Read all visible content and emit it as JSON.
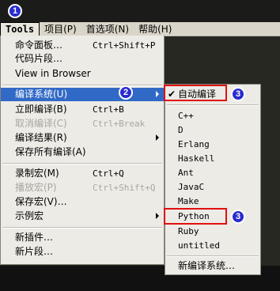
{
  "menubar": {
    "items": [
      {
        "label": "Tools",
        "active": true
      },
      {
        "label": "项目(P)"
      },
      {
        "label": "首选项(N)"
      },
      {
        "label": "帮助(H)"
      }
    ]
  },
  "tools_menu": {
    "items": [
      {
        "label": "命令面板…",
        "shortcut": "Ctrl+Shift+P"
      },
      {
        "label": "代码片段…",
        "shortcut": ""
      },
      {
        "label": "View in Browser",
        "shortcut": ""
      },
      {
        "label": "编译系统(U)",
        "shortcut": "",
        "submenu": true,
        "selected": true
      },
      {
        "label": "立即编译(B)",
        "shortcut": "Ctrl+B"
      },
      {
        "label": "取消编译(C)",
        "shortcut": "Ctrl+Break",
        "disabled": true
      },
      {
        "label": "编译结果(R)",
        "shortcut": "",
        "submenu": true
      },
      {
        "label": "保存所有编译(A)",
        "shortcut": ""
      },
      {
        "label": "录制宏(M)",
        "shortcut": "Ctrl+Q"
      },
      {
        "label": "播放宏(P)",
        "shortcut": "Ctrl+Shift+Q",
        "disabled": true
      },
      {
        "label": "保存宏(V)…",
        "shortcut": ""
      },
      {
        "label": "示例宏",
        "shortcut": "",
        "submenu": true
      },
      {
        "label": "新插件…",
        "shortcut": ""
      },
      {
        "label": "新片段…",
        "shortcut": ""
      }
    ]
  },
  "build_submenu": {
    "items": [
      {
        "label": "自动编译",
        "checked": true
      },
      {
        "label": "C++"
      },
      {
        "label": "D"
      },
      {
        "label": "Erlang"
      },
      {
        "label": "Haskell"
      },
      {
        "label": "Ant"
      },
      {
        "label": "JavaC"
      },
      {
        "label": "Make"
      },
      {
        "label": "Python"
      },
      {
        "label": "Ruby"
      },
      {
        "label": "untitled"
      },
      {
        "label": "新编译系统…"
      }
    ]
  },
  "annotations": {
    "step1": "1",
    "step2": "2",
    "step3a": "3",
    "step3b": "3",
    "highlight_color": "#e01010",
    "badge_color": "#2a2ad0"
  },
  "colors": {
    "selection": "#3169c6",
    "menu_bg": "#ecebe6",
    "editor_bg": "#272822"
  }
}
